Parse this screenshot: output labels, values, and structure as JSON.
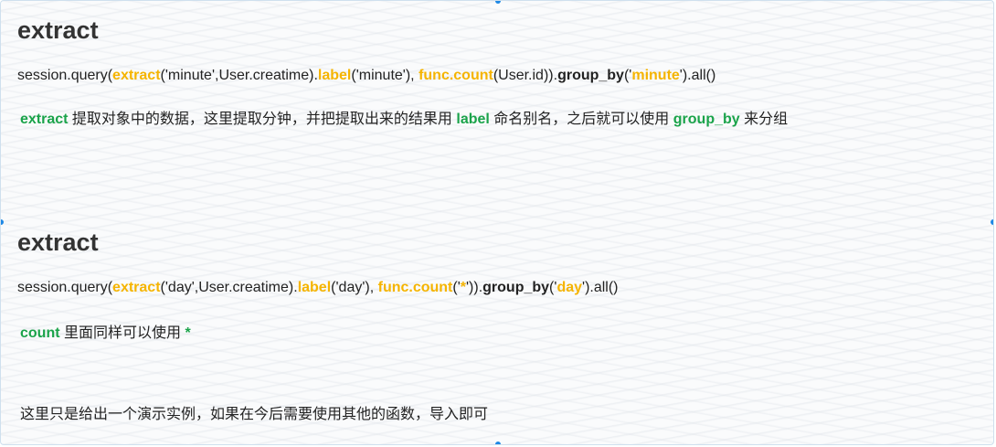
{
  "section1": {
    "heading": "extract",
    "code": {
      "p1": "session.query(",
      "p2": "extract",
      "p3": "('minute',User.creatime).",
      "p4": "label",
      "p5": "('minute'), ",
      "p6": "func.count",
      "p7": "(User.id)).",
      "p8": "group_by",
      "p9": "('",
      "p10": "minute",
      "p11": "').all()"
    },
    "desc": {
      "t1": "extract",
      "t2": " 提取对象中的数据，这里提取分钟，并把提取出来的结果用 ",
      "t3": "label",
      "t4": " 命名别名，之后就可以使用 ",
      "t5": "group_by",
      "t6": " 来分组"
    }
  },
  "section2": {
    "heading": "extract",
    "code": {
      "p1": "session.query(",
      "p2": "extract",
      "p3": "('day',User.creatime).",
      "p4": "label",
      "p5": "('day'), ",
      "p6": "func.count",
      "p7": "('",
      "p8": "*",
      "p9": "')).",
      "p10": "group_by",
      "p11": "('",
      "p12": "day",
      "p13": "').all()"
    },
    "desc": {
      "t1": "count",
      "t2": " 里面同样可以使用 ",
      "t3": "*"
    }
  },
  "note": "这里只是给出一个演示实例，如果在今后需要使用其他的函数，导入即可",
  "colors": {
    "function_highlight": "#f5b400",
    "keyword_green": "#1aa34a",
    "frame_border": "#cfe0ee",
    "handle_blue": "#1e88e5"
  }
}
